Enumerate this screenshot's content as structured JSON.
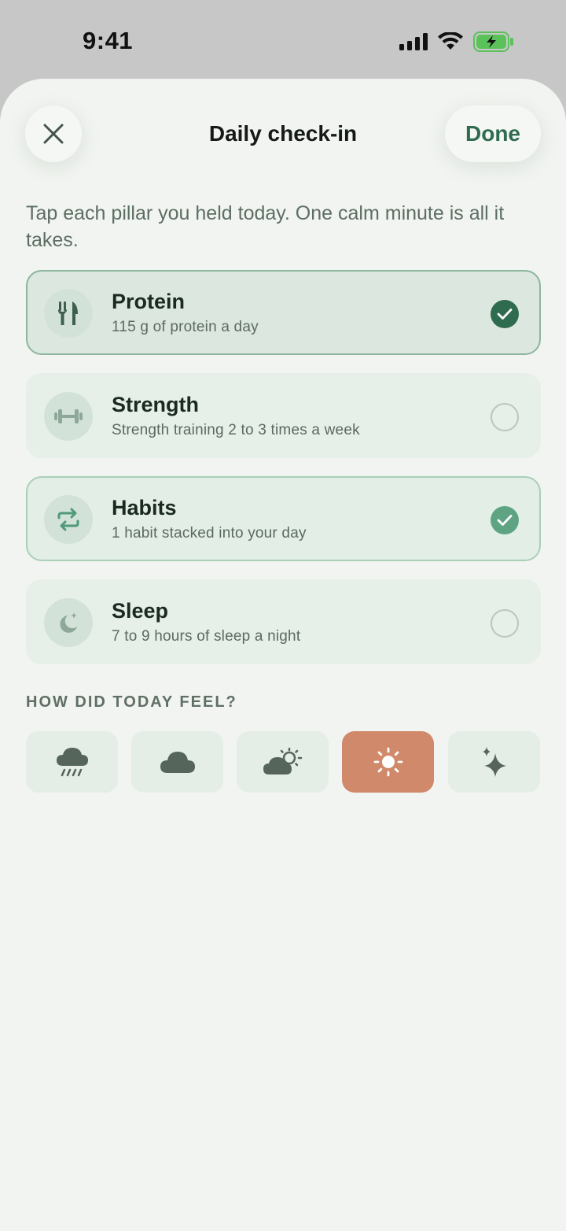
{
  "status_bar": {
    "time": "9:41"
  },
  "header": {
    "title": "Daily check-in",
    "done_label": "Done"
  },
  "intro": "Tap each pillar you held today. One calm minute is all it takes.",
  "pillars": [
    {
      "name": "Protein",
      "description": "115 g of protein a day",
      "icon": "fork-knife-icon",
      "checked": true
    },
    {
      "name": "Strength",
      "description": "Strength training 2 to 3 times a week",
      "icon": "dumbbell-icon",
      "checked": false
    },
    {
      "name": "Habits",
      "description": "1 habit stacked into your day",
      "icon": "repeat-icon",
      "checked": true
    },
    {
      "name": "Sleep",
      "description": "7 to 9 hours of sleep a night",
      "icon": "moon-stars-icon",
      "checked": false
    }
  ],
  "mood_section": {
    "label": "HOW DID TODAY FEEL?",
    "options": [
      {
        "icon": "rain-cloud-icon",
        "selected": false
      },
      {
        "icon": "cloud-icon",
        "selected": false
      },
      {
        "icon": "partly-sunny-icon",
        "selected": false
      },
      {
        "icon": "sun-icon",
        "selected": true
      },
      {
        "icon": "sparkles-icon",
        "selected": false
      }
    ]
  },
  "colors": {
    "accent": "#2f6b4f",
    "accent_light": "#5ea482",
    "selected_mood": "#d0896a",
    "background": "#f1f4f0"
  }
}
